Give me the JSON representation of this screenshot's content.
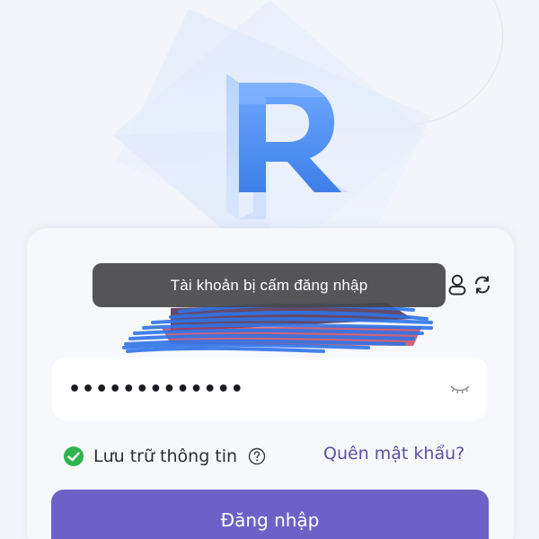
{
  "toast": {
    "message": "Tài khoản bị cấm đăng nhập"
  },
  "logo": {
    "letter": "R",
    "color": "#4a8cf0"
  },
  "username": {
    "status": "redacted"
  },
  "password": {
    "value": "•••••••••••••"
  },
  "remember": {
    "label": "Lưu trữ thông tin",
    "checked": true,
    "check_color": "#2fb34e"
  },
  "forgot_password": {
    "label": "Quên mật khẩu?"
  },
  "login_button": {
    "label": "Đăng nhập",
    "color": "#6f60c7"
  },
  "icons": {
    "account": "user-switch-icon",
    "refresh": "refresh-icon",
    "eye": "eye-closed-icon",
    "check": "check-circle-icon",
    "help": "question-circle-icon"
  }
}
